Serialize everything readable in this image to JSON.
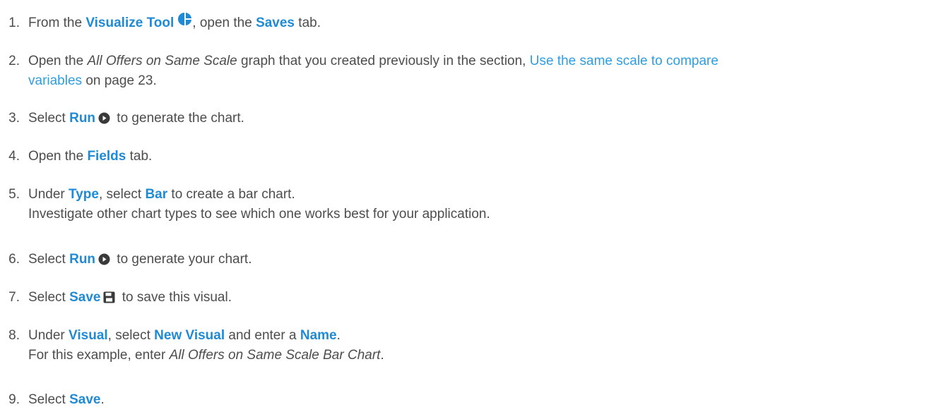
{
  "steps": [
    {
      "num": "1",
      "t1": "From the ",
      "k1": "Visualize Tool",
      "icon": "visualize-tool-icon",
      "t2": ", open the ",
      "k2": "Saves",
      "t3": " tab."
    },
    {
      "num": "2",
      "t1": "Open the ",
      "i1": "All Offers on Same Scale",
      "t2": " graph that you created previously in the section, ",
      "link1": "Use the same scale to compare",
      "link2": "variables",
      "t3": " on page ",
      "page": "23",
      "t4": "."
    },
    {
      "num": "3",
      "t1": "Select ",
      "k1": "Run",
      "icon": "run-icon",
      "t2": " to generate the chart."
    },
    {
      "num": "4",
      "t1": "Open the ",
      "k1": "Fields",
      "t2": " tab."
    },
    {
      "num": "5",
      "t1": "Under ",
      "k1": "Type",
      "t2": ", select ",
      "k2": "Bar",
      "t3": " to create a bar chart.",
      "line2": "Investigate other chart types to see which one works best for your application."
    },
    {
      "num": "6",
      "t1": "Select ",
      "k1": "Run",
      "icon": "run-icon",
      "t2": " to generate your chart."
    },
    {
      "num": "7",
      "t1": "Select ",
      "k1": "Save",
      "icon": "save-icon",
      "t2": " to save this visual."
    },
    {
      "num": "8",
      "t1": "Under ",
      "k1": "Visual",
      "t2": ", select ",
      "k2": "New Visual",
      "t3": " and enter a ",
      "k3": "Name",
      "t4": ".",
      "line2a": "For this example, enter ",
      "line2i": "All Offers on Same Scale Bar Chart",
      "line2b": "."
    },
    {
      "num": "9",
      "t1": "Select ",
      "k1": "Save",
      "t2": "."
    }
  ],
  "colors": {
    "keyword": "#1f8ad6",
    "link": "#2f9ee0",
    "text": "#4d4d4d"
  }
}
